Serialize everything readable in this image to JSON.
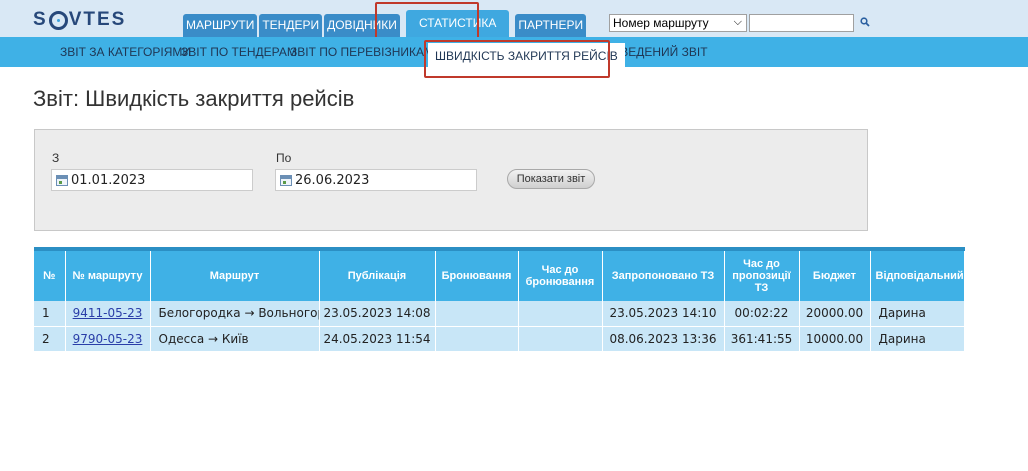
{
  "logo": {
    "text_left": "S",
    "text_right": "VTES"
  },
  "main_nav": {
    "tabs": [
      {
        "label": "МАРШРУТИ"
      },
      {
        "label": "ТЕНДЕРИ"
      },
      {
        "label": "ДОВІДНИКИ"
      },
      {
        "label": "СТАТИСТИКА"
      },
      {
        "label": "ПАРТНЕРИ"
      }
    ],
    "active": "СТАТИСТИКА"
  },
  "search": {
    "select_value": "Номер маршруту",
    "input_value": ""
  },
  "sub_nav": {
    "items": [
      {
        "label": "ЗВІТ ЗА КАТЕГОРІЯМИ"
      },
      {
        "label": "ЗВІТ ПО ТЕНДЕРАМ"
      },
      {
        "label": "ЗВІТ ПО ПЕРЕВІЗНИКАМ"
      },
      {
        "label": "ШВИДКІСТЬ ЗАКРИТТЯ РЕЙСІВ"
      },
      {
        "label": "ЗВЕДЕНИЙ ЗВІТ"
      }
    ],
    "active": "ШВИДКІСТЬ ЗАКРИТТЯ РЕЙСІВ"
  },
  "page": {
    "title": "Звіт: Швидкість закриття рейсів"
  },
  "filter": {
    "from_label": "З",
    "from_value": "01.01.2023",
    "to_label": "По",
    "to_value": "26.06.2023",
    "show_button": "Показати звіт"
  },
  "table": {
    "headers": {
      "index": "№",
      "route_no": "№ маршруту",
      "route": "Маршрут",
      "published": "Публікація",
      "booking": "Бронювання",
      "time_to_booking": "Час до бронювання",
      "offered": "Запропоновано ТЗ",
      "time_to_offer": "Час до пропозиції ТЗ",
      "budget": "Бюджет",
      "responsible": "Відповідальний"
    },
    "rows": [
      {
        "index": "1",
        "route_no": "9411-05-23",
        "route": "Белогородка → Вольногорск",
        "published": "23.05.2023 14:08",
        "booking": "",
        "time_to_booking": "",
        "offered": "23.05.2023 14:10",
        "time_to_offer": "00:02:22",
        "budget": "20000.00",
        "responsible": "Дарина"
      },
      {
        "index": "2",
        "route_no": "9790-05-23",
        "route": "Одесса → Київ",
        "published": "24.05.2023 11:54",
        "booking": "",
        "time_to_booking": "",
        "offered": "08.06.2023 13:36",
        "time_to_offer": "361:41:55",
        "budget": "10000.00",
        "responsible": "Дарина"
      }
    ]
  },
  "colors": {
    "top_bar": "#d9e8f5",
    "sub_bar": "#3fb1e6",
    "tab": "#3a8cc8",
    "tab_active": "#3fa8e0",
    "row_bg": "#c8e6f7",
    "highlight": "#c0392b"
  }
}
